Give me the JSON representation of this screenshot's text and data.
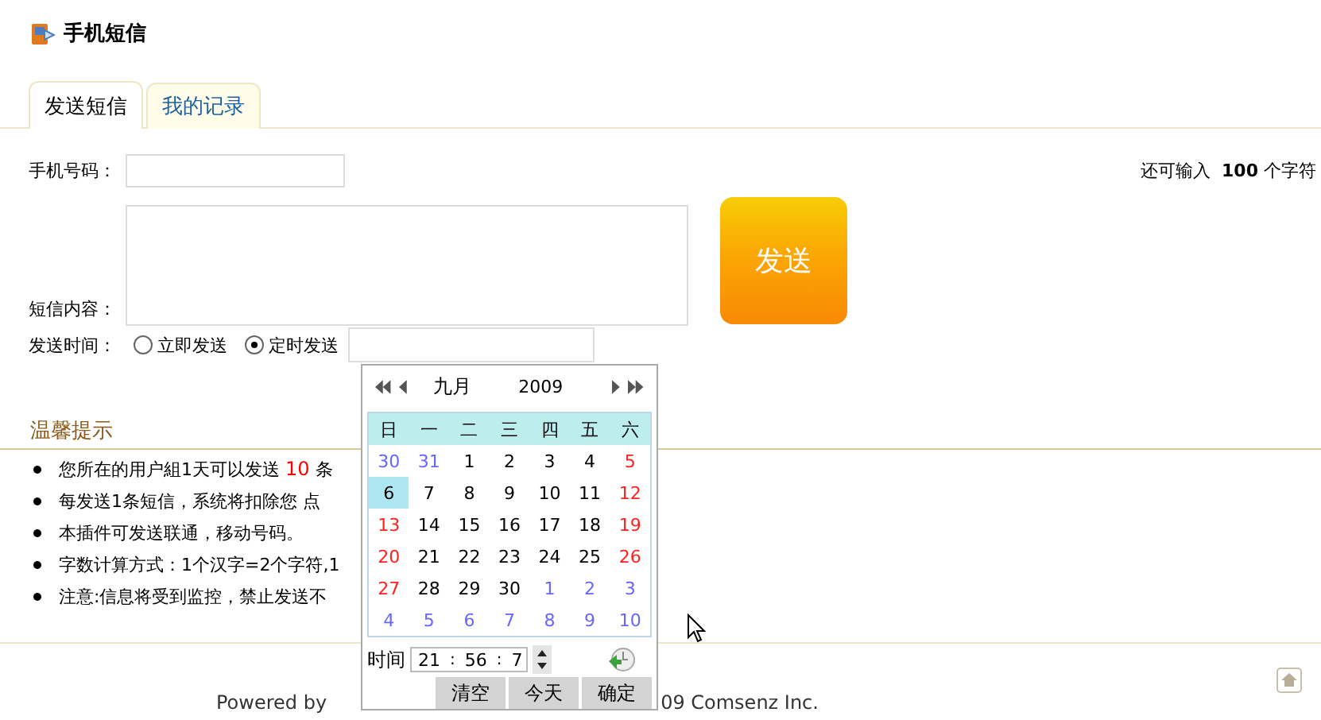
{
  "page_title": "手机短信",
  "tabs": [
    {
      "label": "发送短信",
      "selected": true
    },
    {
      "label": "我的记录",
      "selected": false
    }
  ],
  "form": {
    "phone_label": "手机号码：",
    "content_label": "短信内容：",
    "remaining": {
      "before": "还可输入",
      "count": "100",
      "after": "个字符"
    },
    "send_button": "发送",
    "time_label": "发送时间：",
    "send_modes": [
      {
        "label": "立即发送",
        "selected": false
      },
      {
        "label": "定时发送",
        "selected": true
      }
    ]
  },
  "tips": {
    "title": "温馨提示",
    "items": [
      {
        "text": "您所在的用户組1天可以发送 ",
        "count": "10",
        "after": " 条"
      },
      {
        "text": "每发送1条短信，系统将扣除您 点"
      },
      {
        "text": "本插件可发送联通，移动号码。"
      },
      {
        "text": "字数计算方式：1个汉字=2个字符,1"
      },
      {
        "text": "注意:信息将受到监控，禁止发送不"
      }
    ]
  },
  "calendar": {
    "month": "九月",
    "year": "2009",
    "weekdays": [
      "日",
      "一",
      "二",
      "三",
      "四",
      "五",
      "六"
    ],
    "weeks": [
      [
        {
          "day": "30",
          "kind": "other",
          "selected": false
        },
        {
          "day": "31",
          "kind": "other",
          "selected": false
        },
        {
          "day": "1",
          "kind": "normal",
          "selected": false
        },
        {
          "day": "2",
          "kind": "normal",
          "selected": false
        },
        {
          "day": "3",
          "kind": "normal",
          "selected": false
        },
        {
          "day": "4",
          "kind": "normal",
          "selected": false
        },
        {
          "day": "5",
          "kind": "weekend",
          "selected": false
        }
      ],
      [
        {
          "day": "6",
          "kind": "normal",
          "selected": true
        },
        {
          "day": "7",
          "kind": "normal",
          "selected": false
        },
        {
          "day": "8",
          "kind": "normal",
          "selected": false
        },
        {
          "day": "9",
          "kind": "normal",
          "selected": false
        },
        {
          "day": "10",
          "kind": "normal",
          "selected": false
        },
        {
          "day": "11",
          "kind": "normal",
          "selected": false
        },
        {
          "day": "12",
          "kind": "weekend",
          "selected": false
        }
      ],
      [
        {
          "day": "13",
          "kind": "weekend",
          "selected": false
        },
        {
          "day": "14",
          "kind": "normal",
          "selected": false
        },
        {
          "day": "15",
          "kind": "normal",
          "selected": false
        },
        {
          "day": "16",
          "kind": "normal",
          "selected": false
        },
        {
          "day": "17",
          "kind": "normal",
          "selected": false
        },
        {
          "day": "18",
          "kind": "normal",
          "selected": false
        },
        {
          "day": "19",
          "kind": "weekend",
          "selected": false
        }
      ],
      [
        {
          "day": "20",
          "kind": "weekend",
          "selected": false
        },
        {
          "day": "21",
          "kind": "normal",
          "selected": false
        },
        {
          "day": "22",
          "kind": "normal",
          "selected": false
        },
        {
          "day": "23",
          "kind": "normal",
          "selected": false
        },
        {
          "day": "24",
          "kind": "normal",
          "selected": false
        },
        {
          "day": "25",
          "kind": "normal",
          "selected": false
        },
        {
          "day": "26",
          "kind": "weekend",
          "selected": false
        }
      ],
      [
        {
          "day": "27",
          "kind": "weekend",
          "selected": false
        },
        {
          "day": "28",
          "kind": "normal",
          "selected": false
        },
        {
          "day": "29",
          "kind": "normal",
          "selected": false
        },
        {
          "day": "30",
          "kind": "normal",
          "selected": false
        },
        {
          "day": "1",
          "kind": "other",
          "selected": false
        },
        {
          "day": "2",
          "kind": "other",
          "selected": false
        },
        {
          "day": "3",
          "kind": "other",
          "selected": false
        }
      ],
      [
        {
          "day": "4",
          "kind": "other",
          "selected": false
        },
        {
          "day": "5",
          "kind": "other",
          "selected": false
        },
        {
          "day": "6",
          "kind": "other",
          "selected": false
        },
        {
          "day": "7",
          "kind": "other",
          "selected": false
        },
        {
          "day": "8",
          "kind": "other",
          "selected": false
        },
        {
          "day": "9",
          "kind": "other",
          "selected": false
        },
        {
          "day": "10",
          "kind": "other",
          "selected": false
        }
      ]
    ],
    "time_label": "时间",
    "hour": "21",
    "minute": "56",
    "second": "7",
    "separator": ":",
    "buttons": [
      "清空",
      "今天",
      "确定"
    ]
  },
  "footer": {
    "left": "Powered by",
    "right": "09 Comsenz Inc."
  }
}
